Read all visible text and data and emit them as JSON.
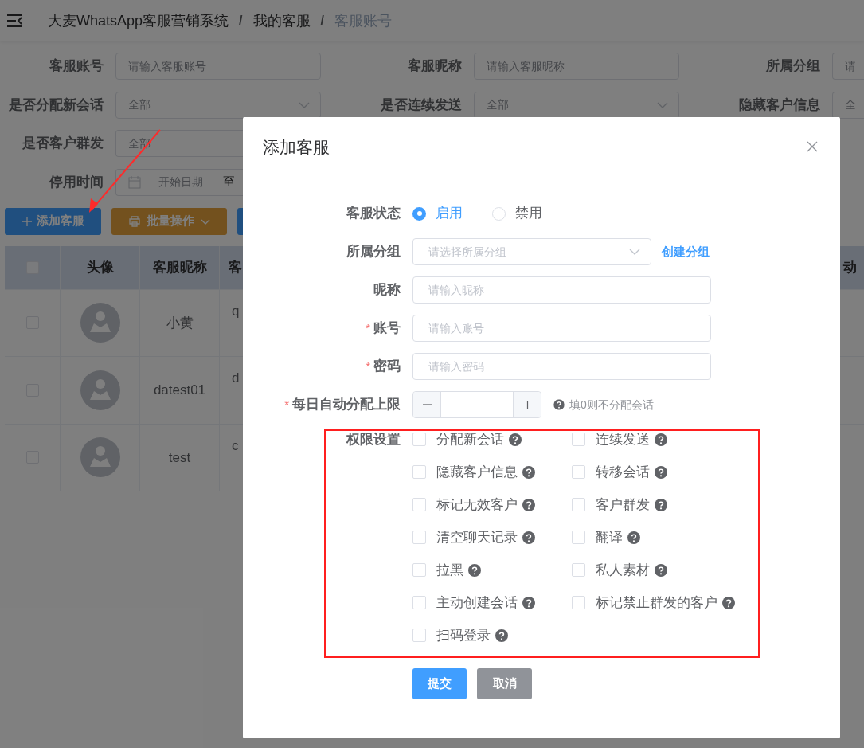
{
  "breadcrumb": [
    {
      "label": "大麦WhatsApp客服营销系统",
      "current": false
    },
    {
      "separator": "/",
      "label": "我的客服",
      "current": false
    },
    {
      "separator": "/",
      "label": "客服账号",
      "current": true
    }
  ],
  "filters": [
    [
      {
        "label": "客服账号",
        "kind": "input",
        "placeholder": "请输入客服账号"
      },
      {
        "label": "客服昵称",
        "kind": "input",
        "placeholder": "请输入客服昵称"
      },
      {
        "label": "所属分组",
        "kind": "input",
        "placeholder": "请"
      }
    ],
    [
      {
        "label": "是否分配新会话",
        "kind": "select",
        "value": "全部"
      },
      {
        "label": "是否连续发送",
        "kind": "select",
        "value": "全部"
      },
      {
        "label": "隐藏客户信息",
        "kind": "select",
        "value": "全"
      }
    ],
    [
      {
        "label": "是否客户群发",
        "kind": "select",
        "value": "全部"
      }
    ],
    [
      {
        "label": "停用时间",
        "kind": "date",
        "placeholder": "开始日期",
        "separator": "至"
      }
    ]
  ],
  "toolbar": [
    {
      "label": "添加客服",
      "kind": "add"
    },
    {
      "label": "批量操作",
      "kind": "batch"
    },
    {
      "kind": "covered"
    }
  ],
  "table": {
    "header_checked": false,
    "columns": [
      "头像",
      "客服昵称",
      "客",
      "动"
    ],
    "rows": [
      {
        "nickname": "小黄",
        "column_4": "q",
        "checked": false
      },
      {
        "nickname": "datest01",
        "column_4": "d",
        "checked": false
      },
      {
        "nickname": "test",
        "column_4": "c",
        "checked": false
      }
    ]
  },
  "dialog": {
    "title": "添加客服",
    "fields": [
      {
        "kind": "radio",
        "label": "客服状态",
        "options": [
          {
            "label": "启用",
            "selected": true
          },
          {
            "label": "禁用",
            "selected": false
          }
        ]
      },
      {
        "kind": "select",
        "label": "所属分组",
        "placeholder": "请选择所属分组",
        "link": "创建分组"
      },
      {
        "kind": "input",
        "label": "昵称",
        "placeholder": "请输入昵称"
      },
      {
        "kind": "input",
        "label": "账号",
        "required_mark": "*",
        "placeholder": "请输入账号"
      },
      {
        "kind": "input",
        "label": "密码",
        "required_mark": "*",
        "placeholder": "请输入密码"
      },
      {
        "kind": "number",
        "label": "每日自动分配上限",
        "required_mark": "*",
        "hint": "填0则不分配会话"
      }
    ],
    "permissions": {
      "label": "权限设置",
      "items": [
        {
          "label": "分配新会话",
          "checked": false
        },
        {
          "label": "连续发送",
          "checked": false
        },
        {
          "label": "隐藏客户信息",
          "checked": false
        },
        {
          "label": "转移会话",
          "checked": false
        },
        {
          "label": "标记无效客户",
          "checked": false
        },
        {
          "label": "客户群发",
          "checked": false
        },
        {
          "label": "清空聊天记录",
          "checked": false
        },
        {
          "label": "翻译",
          "checked": false
        },
        {
          "label": "拉黑",
          "checked": false
        },
        {
          "label": "私人素材",
          "checked": false
        },
        {
          "label": "主动创建会话",
          "checked": false
        },
        {
          "label": "标记禁止群发的客户",
          "checked": false
        },
        {
          "label": "扫码登录",
          "checked": false
        }
      ]
    },
    "buttons": [
      {
        "label": "提交",
        "kind": "primary"
      },
      {
        "label": "取消",
        "kind": "cancel"
      }
    ]
  }
}
